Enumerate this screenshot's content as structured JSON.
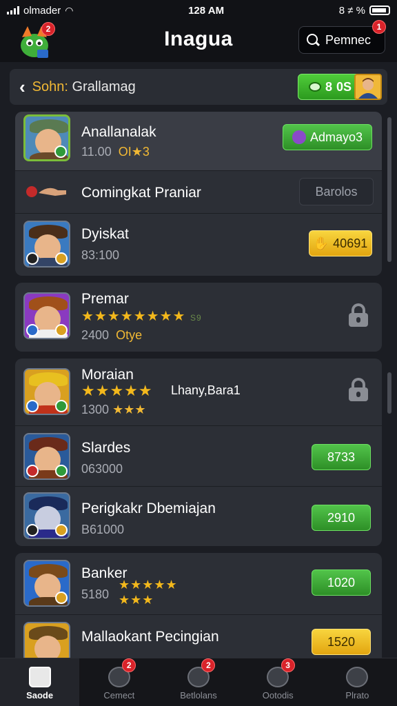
{
  "status_bar": {
    "carrier": "olmader",
    "time": "128 AM",
    "right_text": "8 ≠ %"
  },
  "header": {
    "title": "Inagua",
    "search_text": "Pemnec",
    "mascot_badge": "2",
    "search_badge": "1"
  },
  "subheader": {
    "back_icon": "chevron-left",
    "title_left": "Sohn:",
    "title_right": "Grallamag",
    "coin_value": "0S",
    "coin_prefix": "8"
  },
  "groups": [
    {
      "rows": [
        {
          "name": "Anallanalak",
          "sub": "11.00",
          "sub_gold": "OI★3",
          "button": "Admayo3",
          "button_style": "green",
          "highlight": true
        },
        {
          "name": "Comingkat Praniar",
          "button": "Barolos",
          "button_style": "dark"
        },
        {
          "name": "Dyiskat",
          "sub": "83:100",
          "button": "40691",
          "button_style": "gold"
        }
      ]
    },
    {
      "rows": [
        {
          "name": "Premar",
          "stars": "★★★★★★★★",
          "stars_suffix": "S9",
          "sub": "2400",
          "sub_gold": "Otye",
          "locked": true
        }
      ]
    },
    {
      "rows": [
        {
          "name": "Moraian",
          "stars": "★★★★★",
          "extra": "Lhany,Bara1",
          "sub": "1300",
          "sub_gold": "★★★",
          "locked": true
        },
        {
          "name": "Slardes",
          "sub": "063000",
          "button": "8733",
          "button_style": "green"
        },
        {
          "name": "Perigkakr Dbemiajan",
          "sub": "B61000",
          "button": "2910",
          "button_style": "green"
        }
      ]
    },
    {
      "rows": [
        {
          "name": "Banker",
          "sub": "5180",
          "stars": "★★★★★",
          "stars2": "★★★",
          "button": "1020",
          "button_style": "green"
        },
        {
          "name": "Mallaokant Pecingian",
          "button": "1520",
          "button_style": "gold"
        }
      ]
    }
  ],
  "bottom_nav": [
    {
      "label": "Saode",
      "active": true
    },
    {
      "label": "Cemect",
      "badge": "2"
    },
    {
      "label": "Betlolans",
      "badge": "2"
    },
    {
      "label": "Ootodis",
      "badge": "3"
    },
    {
      "label": "Plrato"
    }
  ],
  "colors": {
    "accent_green": "#52c44a",
    "accent_gold": "#f8d53e",
    "badge_red": "#d9232a",
    "background": "#1b1d23"
  }
}
